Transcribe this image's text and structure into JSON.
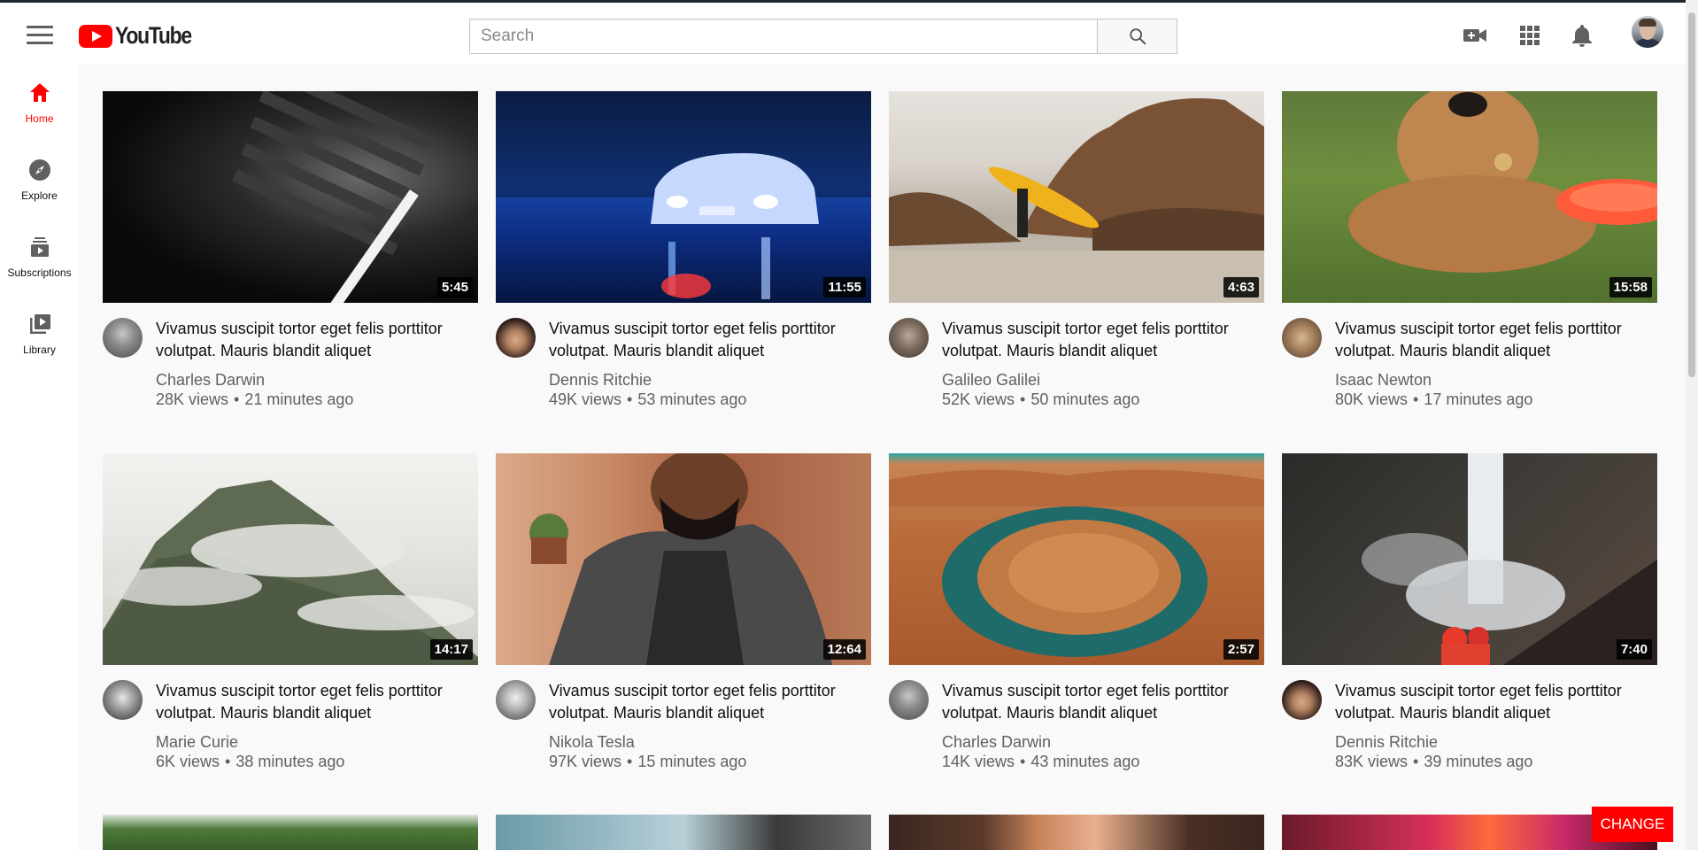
{
  "app": {
    "logo_text": "YouTube",
    "brand_color": "#ff0000"
  },
  "header": {
    "search_placeholder": "Search",
    "icons": [
      "menu-icon",
      "search-icon",
      "video-camera-icon",
      "apps-grid-icon",
      "notifications-bell-icon",
      "user-avatar"
    ]
  },
  "sidebar": {
    "items": [
      {
        "label": "Home",
        "icon": "home-icon",
        "active": true
      },
      {
        "label": "Explore",
        "icon": "explore-compass-icon",
        "active": false
      },
      {
        "label": "Subscriptions",
        "icon": "subscriptions-icon",
        "active": false
      },
      {
        "label": "Library",
        "icon": "library-icon",
        "active": false
      }
    ]
  },
  "videos": [
    {
      "duration": "5:45",
      "title": "Vivamus suscipit tortor eget felis porttitor volutpat. Mauris blandit aliquet",
      "channel": "Charles Darwin",
      "views": "28K views",
      "time": "21 minutes ago"
    },
    {
      "duration": "11:55",
      "title": "Vivamus suscipit tortor eget felis porttitor volutpat. Mauris blandit aliquet",
      "channel": "Dennis Ritchie",
      "views": "49K views",
      "time": "53 minutes ago"
    },
    {
      "duration": "4:63",
      "title": "Vivamus suscipit tortor eget felis porttitor volutpat. Mauris blandit aliquet",
      "channel": "Galileo Galilei",
      "views": "52K views",
      "time": "50 minutes ago"
    },
    {
      "duration": "15:58",
      "title": "Vivamus suscipit tortor eget felis porttitor volutpat. Mauris blandit aliquet",
      "channel": "Isaac Newton",
      "views": "80K views",
      "time": "17 minutes ago"
    },
    {
      "duration": "14:17",
      "title": "Vivamus suscipit tortor eget felis porttitor volutpat. Mauris blandit aliquet",
      "channel": "Marie Curie",
      "views": "6K views",
      "time": "38 minutes ago"
    },
    {
      "duration": "12:64",
      "title": "Vivamus suscipit tortor eget felis porttitor volutpat. Mauris blandit aliquet",
      "channel": "Nikola Tesla",
      "views": "97K views",
      "time": "15 minutes ago"
    },
    {
      "duration": "2:57",
      "title": "Vivamus suscipit tortor eget felis porttitor volutpat. Mauris blandit aliquet",
      "channel": "Charles Darwin",
      "views": "14K views",
      "time": "43 minutes ago"
    },
    {
      "duration": "7:40",
      "title": "Vivamus suscipit tortor eget felis porttitor volutpat. Mauris blandit aliquet",
      "channel": "Dennis Ritchie",
      "views": "83K views",
      "time": "39 minutes ago"
    }
  ],
  "dot_separator": "•",
  "change_button": {
    "label": "CHANGE"
  }
}
